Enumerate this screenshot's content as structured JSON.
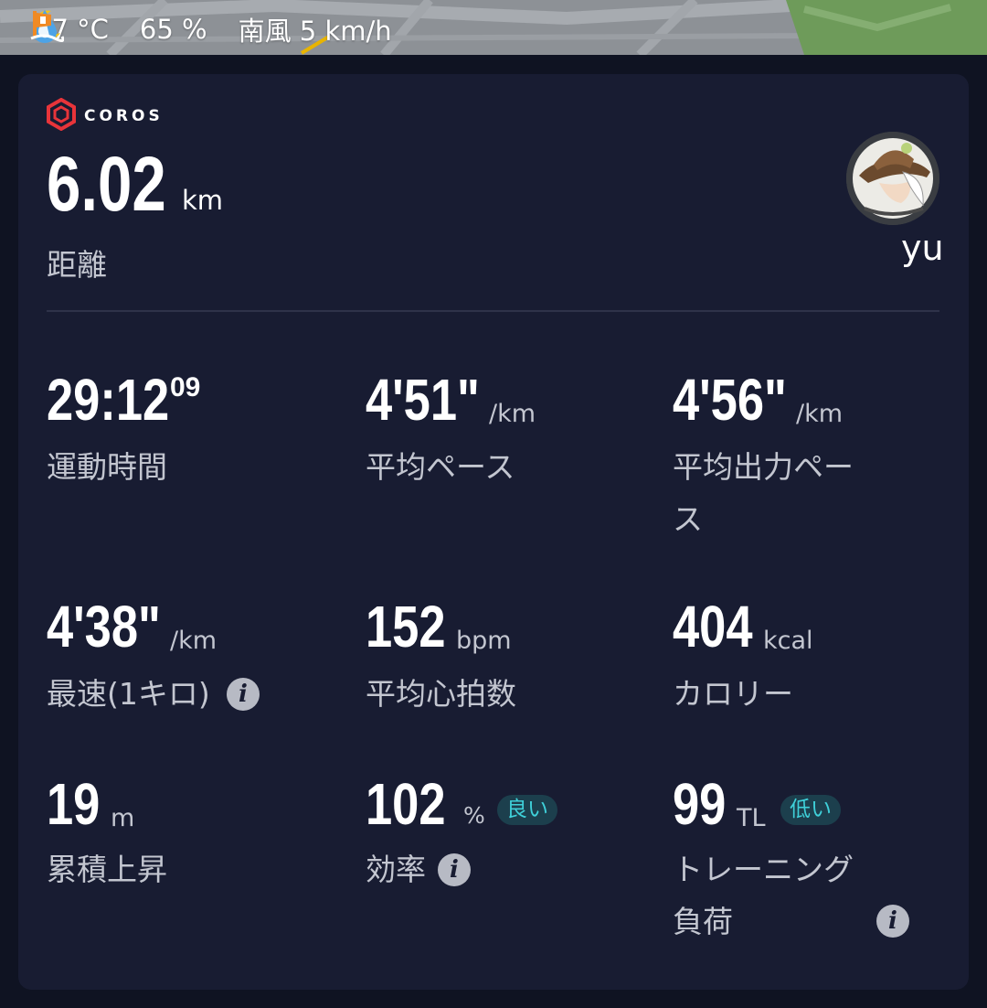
{
  "weather": {
    "temperature": "27 °C",
    "humidity": "65 %",
    "wind": "南風 5 km/h"
  },
  "card": {
    "brand": "COROS",
    "distance": {
      "value": "6.02",
      "unit": "km",
      "label": "距離"
    },
    "user": {
      "name": "yu"
    }
  },
  "stats": {
    "moving_time": {
      "value": "29:12",
      "sup": "09",
      "label": "運動時間"
    },
    "avg_pace": {
      "value": "4'51\"",
      "unit": "/km",
      "label": "平均ペース"
    },
    "avg_power_pace": {
      "value": "4'56\"",
      "unit": "/km",
      "label_line1": "平均出力ペー",
      "label_line2": "ス"
    },
    "best_km": {
      "value": "4'38\"",
      "unit": "/km",
      "label": "最速(1キロ)"
    },
    "avg_hr": {
      "value": "152",
      "unit": "bpm",
      "label": "平均心拍数"
    },
    "calories": {
      "value": "404",
      "unit": "kcal",
      "label": "カロリー"
    },
    "elevation_gain": {
      "value": "19",
      "unit": "m",
      "label": "累積上昇"
    },
    "efficiency": {
      "value": "102",
      "unit": "%",
      "badge": "良い",
      "label": "効率"
    },
    "training_load": {
      "value": "99",
      "unit": "TL",
      "badge": "低い",
      "label_line1": "トレーニング",
      "label_line2": "負荷"
    }
  },
  "colors": {
    "background": "#0f1322",
    "card": "#181c32",
    "accent_cyan": "#3fd0d9",
    "badge_bg": "#1c3f4d",
    "brand_red": "#e8343a"
  }
}
